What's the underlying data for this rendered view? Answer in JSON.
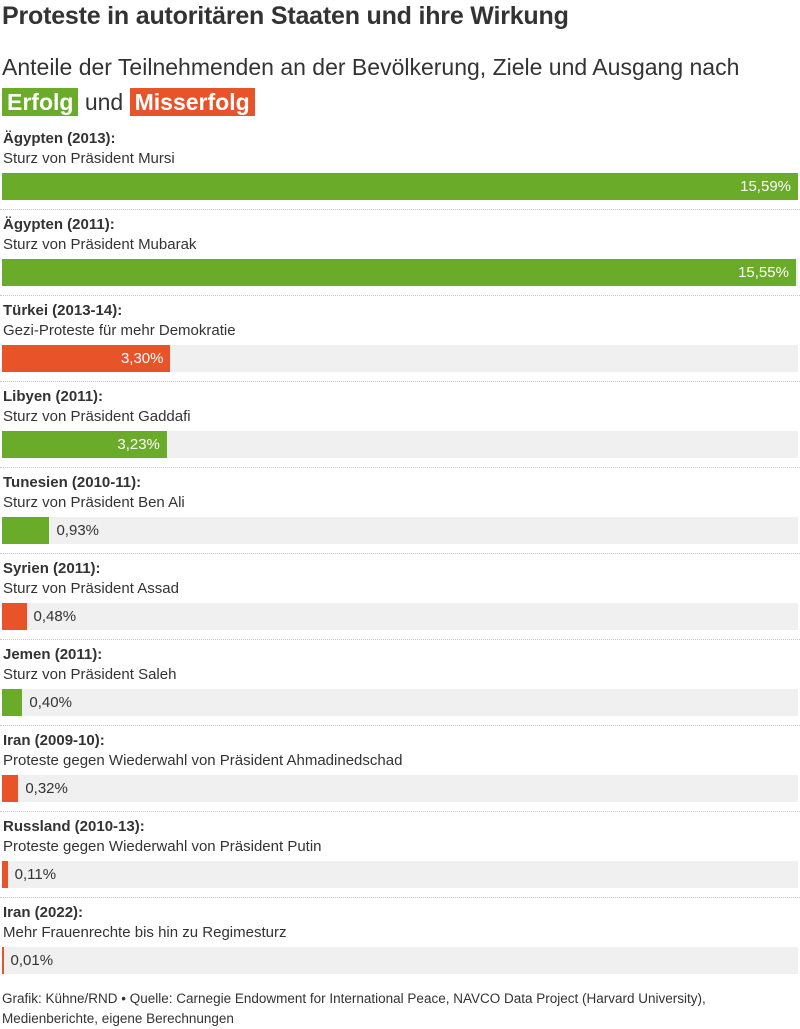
{
  "title": "Proteste in autoritären Staaten und ihre Wirkung",
  "subtitle_prefix": "Anteile der Teilnehmenden an der Bevölkerung, Ziele und Ausgang nach",
  "legend": {
    "success_label": "Erfolg",
    "connector": "und",
    "failure_label": "Misserfolg"
  },
  "colors": {
    "success": "#6aab2a",
    "failure": "#e8532a",
    "track": "#f0f0f0",
    "text": "#333333"
  },
  "chart_data": {
    "type": "bar",
    "orientation": "horizontal",
    "unit": "%",
    "xlim": [
      0,
      15.59
    ],
    "grid": false,
    "items": [
      {
        "country": "Ägypten (2013):",
        "goal": "Sturz von Präsident Mursi",
        "value": 15.59,
        "label": "15,59%",
        "outcome": "Erfolg"
      },
      {
        "country": "Ägypten (2011):",
        "goal": "Sturz von Präsident Mubarak",
        "value": 15.55,
        "label": "15,55%",
        "outcome": "Erfolg"
      },
      {
        "country": "Türkei (2013-14):",
        "goal": "Gezi-Proteste für mehr Demokratie",
        "value": 3.3,
        "label": "3,30%",
        "outcome": "Misserfolg"
      },
      {
        "country": "Libyen (2011):",
        "goal": "Sturz von Präsident Gaddafi",
        "value": 3.23,
        "label": "3,23%",
        "outcome": "Erfolg"
      },
      {
        "country": "Tunesien (2010-11):",
        "goal": "Sturz von Präsident Ben Ali",
        "value": 0.93,
        "label": "0,93%",
        "outcome": "Erfolg"
      },
      {
        "country": "Syrien (2011):",
        "goal": "Sturz von Präsident Assad",
        "value": 0.48,
        "label": "0,48%",
        "outcome": "Misserfolg"
      },
      {
        "country": "Jemen (2011):",
        "goal": "Sturz von Präsident Saleh",
        "value": 0.4,
        "label": "0,40%",
        "outcome": "Erfolg"
      },
      {
        "country": "Iran (2009-10):",
        "goal": "Proteste gegen Wiederwahl von Präsident Ahmadinedschad",
        "value": 0.32,
        "label": "0,32%",
        "outcome": "Misserfolg"
      },
      {
        "country": "Russland (2010-13):",
        "goal": "Proteste gegen Wiederwahl von Präsident Putin",
        "value": 0.11,
        "label": "0,11%",
        "outcome": "Misserfolg"
      },
      {
        "country": "Iran (2022):",
        "goal": "Mehr Frauenrechte bis hin zu Regimesturz",
        "value": 0.01,
        "label": "0,01%",
        "outcome": "Misserfolg"
      }
    ]
  },
  "footer": "Grafik: Kühne/RND • Quelle: Carnegie Endowment for International Peace, NAVCO Data Project (Harvard University), Medienberichte, eigene Berechnungen"
}
